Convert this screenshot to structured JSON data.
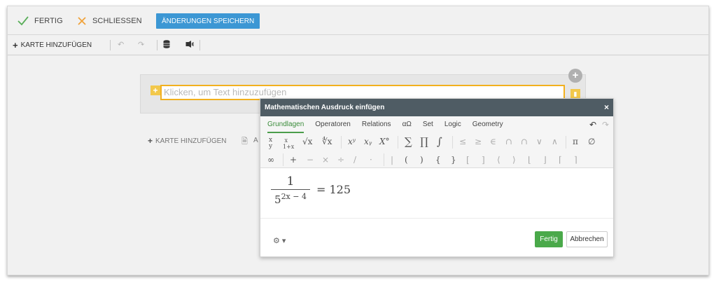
{
  "toolbar": {
    "done_label": "FERTIG",
    "close_label": "SCHLIESSEN",
    "save_label": "ÄNDERUNGEN SPEICHERN",
    "accent_green": "#5aae5a",
    "accent_orange": "#f0a23a",
    "save_color": "#3c97d4"
  },
  "subbar": {
    "add_card_label": "KARTE HINZUFÜGEN",
    "icons": [
      "undo-icon",
      "redo-icon",
      "database-icon",
      "speaker-icon"
    ]
  },
  "card": {
    "placeholder": "Klicken, um Text hinzuzufügen",
    "add_card_label": "KARTE HINZUFÜGEN",
    "truncated_label": "A"
  },
  "dialog": {
    "title": "Mathematischen Ausdruck einfügen",
    "close": "×",
    "tabs": [
      "Grundlagen",
      "Operatoren",
      "Relations",
      "αΩ",
      "Set",
      "Logic",
      "Geometry"
    ],
    "active_tab": "Grundlagen",
    "undo": "↶",
    "redo": "↷",
    "symbols_row1": {
      "frac": "x/y",
      "sqrt": "√x",
      "nthroot": "∜x",
      "power": "xʸ",
      "sub": "xᵧ",
      "deg": "X°",
      "sum": "∑",
      "prod": "∏",
      "int": "∫",
      "le": "≤",
      "ge": "≥",
      "in": "∈",
      "cap": "∩",
      "cap2": "∩",
      "or": "∨",
      "and": "∧",
      "pi": "π",
      "empty": "∅"
    },
    "symbols_row2": [
      "∞",
      "+",
      "−",
      "×",
      "÷",
      "/",
      "·",
      "|",
      "(",
      ")",
      "{",
      "}",
      "[",
      "]",
      "⟨",
      "⟩",
      "⌊",
      "⌋",
      "⌈",
      "⌉"
    ],
    "expression": {
      "numerator": "1",
      "base": "5",
      "exponent": "2x − 4",
      "rhs": "= 125"
    },
    "settings_caret": "⚙ ▾",
    "done_label": "Fertig",
    "cancel_label": "Abbrechen"
  }
}
